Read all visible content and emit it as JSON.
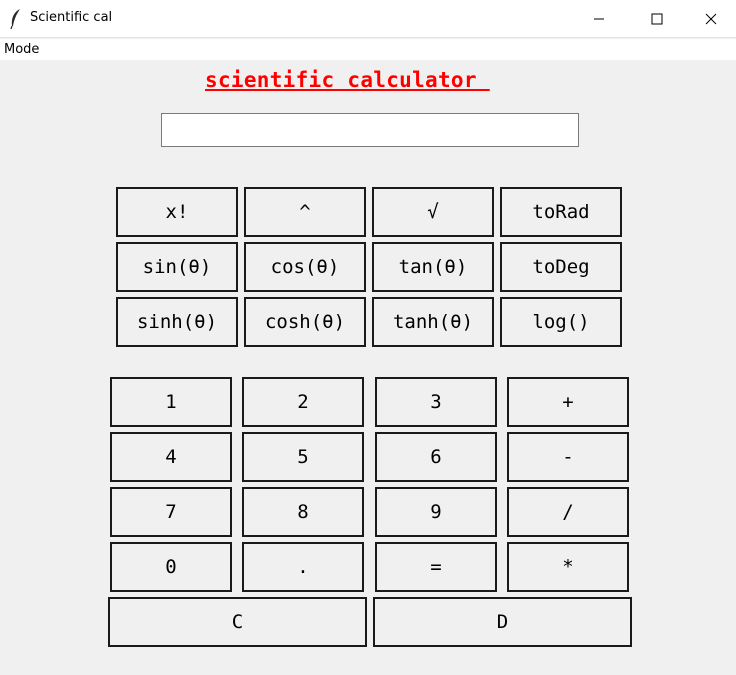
{
  "window": {
    "title": "Scientific cal",
    "controls": {
      "minimize_icon": "minimize-icon",
      "maximize_icon": "maximize-icon",
      "close_icon": "close-icon"
    }
  },
  "menu": {
    "items": [
      "Mode"
    ]
  },
  "heading": "scientific calculator ",
  "display": {
    "value": ""
  },
  "scientific_buttons": [
    [
      "x!",
      "^",
      "√",
      "toRad"
    ],
    [
      "sin(θ)",
      "cos(θ)",
      "tan(θ)",
      "toDeg"
    ],
    [
      "sinh(θ)",
      "cosh(θ)",
      "tanh(θ)",
      "log()"
    ]
  ],
  "number_buttons": [
    [
      "1",
      "2",
      "3",
      "+"
    ],
    [
      "4",
      "5",
      "6",
      "-"
    ],
    [
      "7",
      "8",
      "9",
      "/"
    ],
    [
      "0",
      ".",
      "=",
      "*"
    ]
  ],
  "bottom_buttons": [
    "C",
    "D"
  ],
  "colors": {
    "heading": "#ff0000",
    "background": "#f0f0f0",
    "button_border": "#1a1a1a"
  }
}
